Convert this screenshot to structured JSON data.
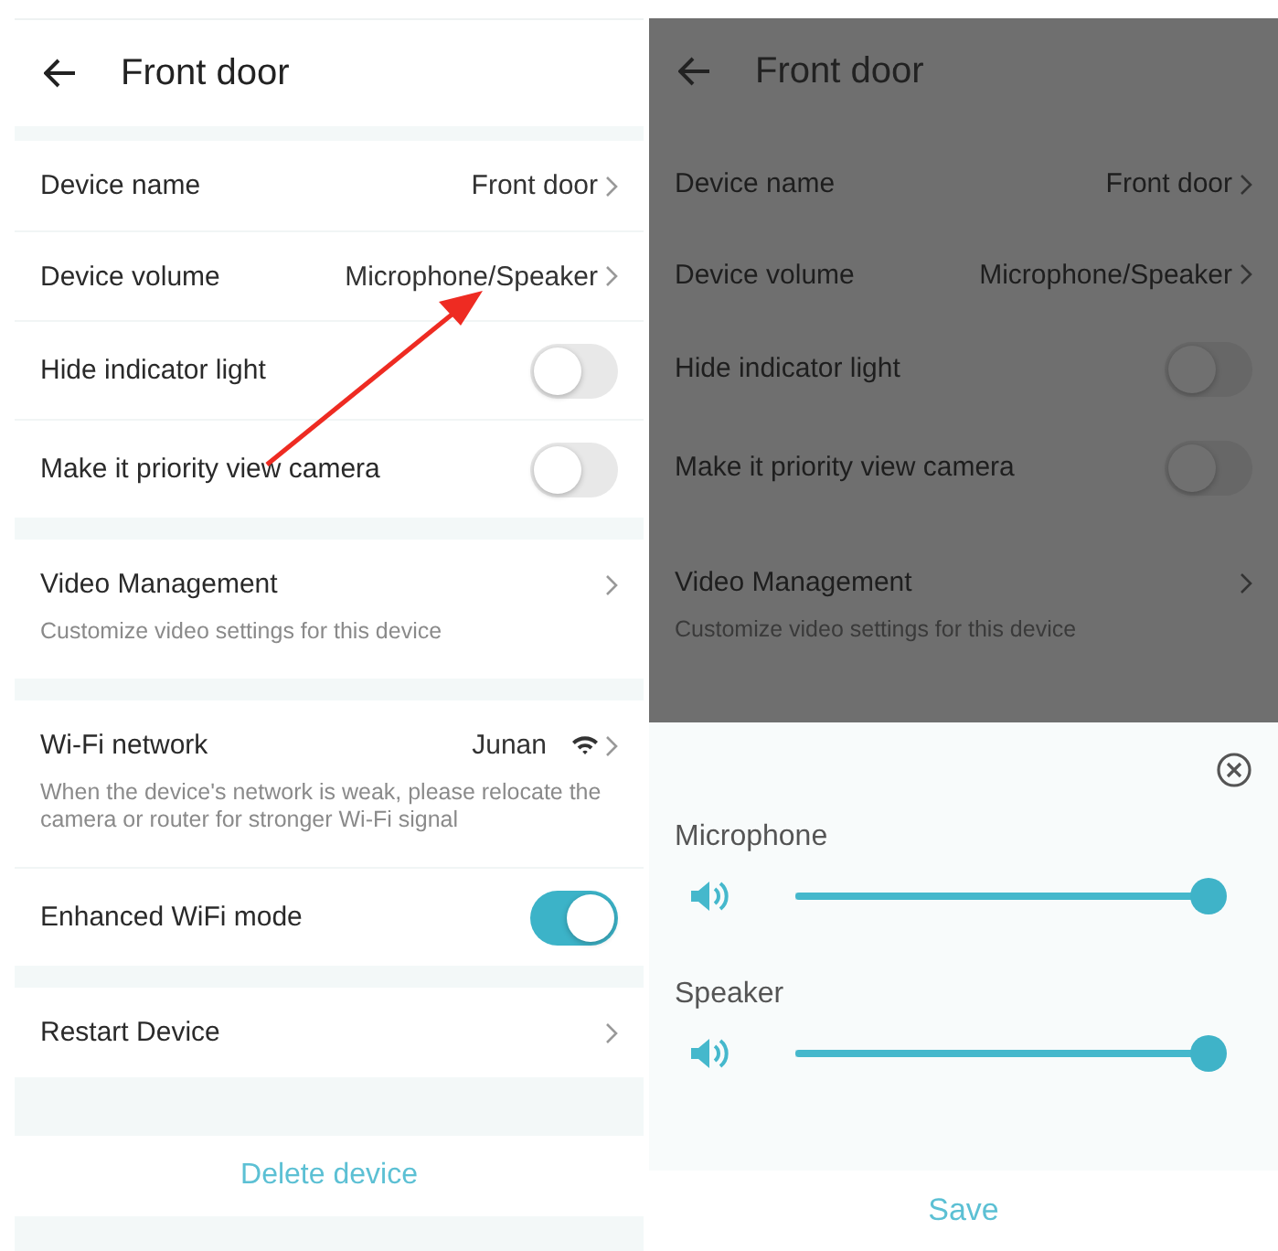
{
  "settings_screen": {
    "title": "Front door",
    "groups": [
      [
        {
          "kind": "link",
          "label": "Device name",
          "value": "Front door"
        },
        {
          "kind": "link",
          "label": "Device volume",
          "value": "Microphone/Speaker"
        },
        {
          "kind": "toggle",
          "label": "Hide indicator light",
          "on": false
        },
        {
          "kind": "toggle",
          "label": "Make it priority view camera",
          "on": false
        }
      ],
      [
        {
          "kind": "link",
          "label": "Video Management",
          "hint": "Customize video settings for this device"
        }
      ],
      [
        {
          "kind": "network",
          "label": "Wi-Fi network",
          "value": "Junan",
          "hint": "When the device's network is weak, please relocate the camera or router for stronger Wi-Fi signal"
        },
        {
          "kind": "toggle",
          "label": "Enhanced WiFi mode",
          "on": true
        }
      ],
      [
        {
          "kind": "link",
          "label": "Restart Device"
        }
      ]
    ],
    "delete_button": "Delete device"
  },
  "volume_screen": {
    "title": "Front door",
    "groups": [
      [
        {
          "kind": "link",
          "label": "Device name",
          "value": "Front door"
        },
        {
          "kind": "link",
          "label": "Device volume",
          "value": "Microphone/Speaker"
        },
        {
          "kind": "toggle",
          "label": "Hide indicator light",
          "on": false
        },
        {
          "kind": "toggle",
          "label": "Make it priority view camera",
          "on": false
        }
      ],
      [
        {
          "kind": "link",
          "label": "Video Management",
          "hint": "Customize video settings for this device"
        }
      ]
    ],
    "sheet": {
      "sliders": [
        {
          "label": "Microphone",
          "level": 1
        },
        {
          "label": "Speaker",
          "level": 1
        }
      ],
      "save_button": "Save"
    }
  }
}
